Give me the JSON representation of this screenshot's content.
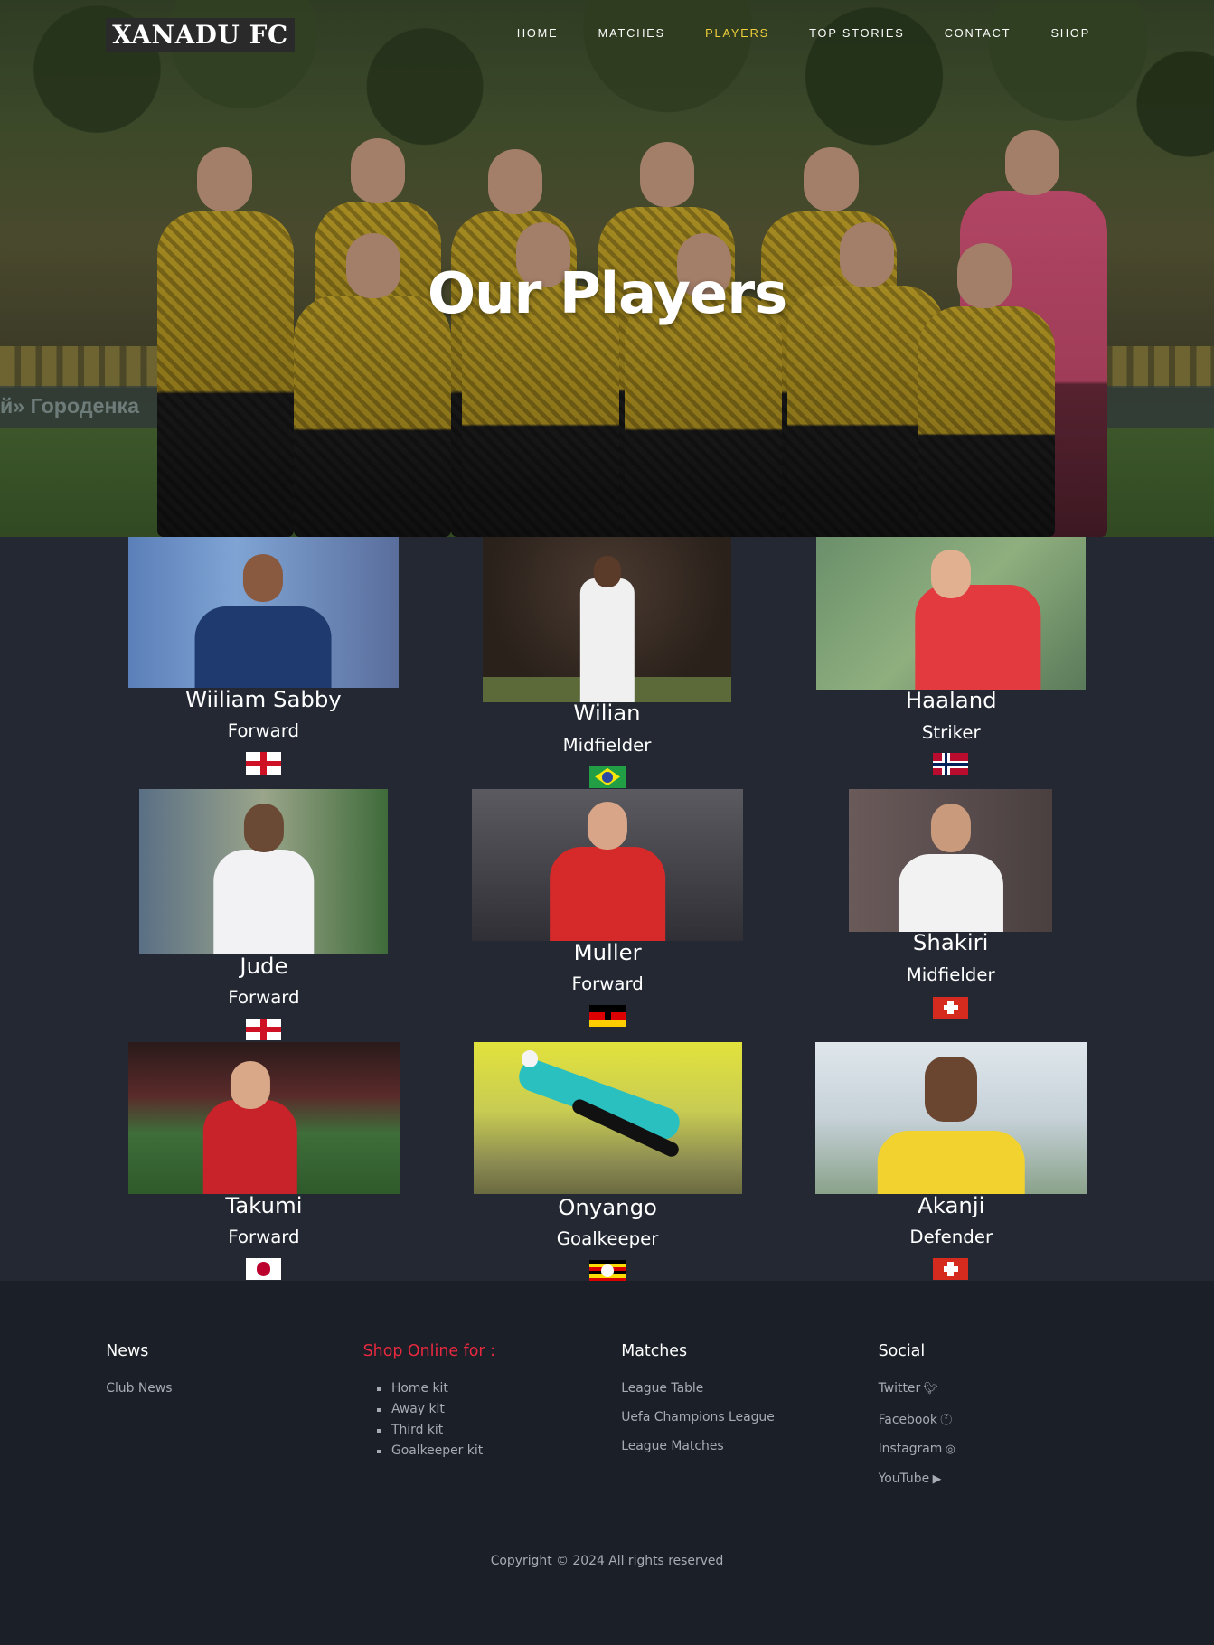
{
  "brand": {
    "logo_text": "XANADU FC"
  },
  "nav": {
    "items": [
      {
        "label": "HOME",
        "active": false
      },
      {
        "label": "MATCHES",
        "active": false
      },
      {
        "label": "PLAYERS",
        "active": true
      },
      {
        "label": "TOP STORIES",
        "active": false
      },
      {
        "label": "CONTACT",
        "active": false
      },
      {
        "label": "SHOP",
        "active": false
      }
    ],
    "active_color": "#f1d13a"
  },
  "hero": {
    "title": "Our Players",
    "banner_text": "й» Городенка"
  },
  "players": [
    {
      "name": "Wiiliam Sabby",
      "position": "Forward",
      "flag": "england-flag-icon"
    },
    {
      "name": "Wilian",
      "position": "Midfielder",
      "flag": "brazil-flag-icon"
    },
    {
      "name": "Haaland",
      "position": "Striker",
      "flag": "norway-flag-icon"
    },
    {
      "name": "Jude",
      "position": "Forward",
      "flag": "england-flag-icon"
    },
    {
      "name": "Muller",
      "position": "Forward",
      "flag": "germany-flag-icon"
    },
    {
      "name": "Shakiri",
      "position": "Midfielder",
      "flag": "switzerland-flag-icon"
    },
    {
      "name": "Takumi",
      "position": "Forward",
      "flag": "japan-flag-icon"
    },
    {
      "name": "Onyango",
      "position": "Goalkeeper",
      "flag": "uganda-flag-icon"
    },
    {
      "name": "Akanji",
      "position": "Defender",
      "flag": "switzerland-flag-icon"
    }
  ],
  "footer": {
    "news": {
      "heading": "News",
      "links": [
        "Club News"
      ]
    },
    "shop": {
      "heading": "Shop Online for :",
      "items": [
        "Home kit",
        "Away kit",
        "Third kit",
        "Goalkeeper kit"
      ],
      "heading_color": "#e8293f"
    },
    "matches": {
      "heading": "Matches",
      "links": [
        "League Table",
        "Uefa Champions League",
        "League Matches"
      ]
    },
    "social": {
      "heading": "Social",
      "links": [
        {
          "label": "Twitter",
          "icon": "twitter-icon"
        },
        {
          "label": "Facebook",
          "icon": "facebook-icon"
        },
        {
          "label": "Instagram",
          "icon": "instagram-icon"
        },
        {
          "label": "YouTube",
          "icon": "youtube-icon"
        }
      ]
    },
    "copyright": "Copyright © 2024 All rights reserved"
  }
}
